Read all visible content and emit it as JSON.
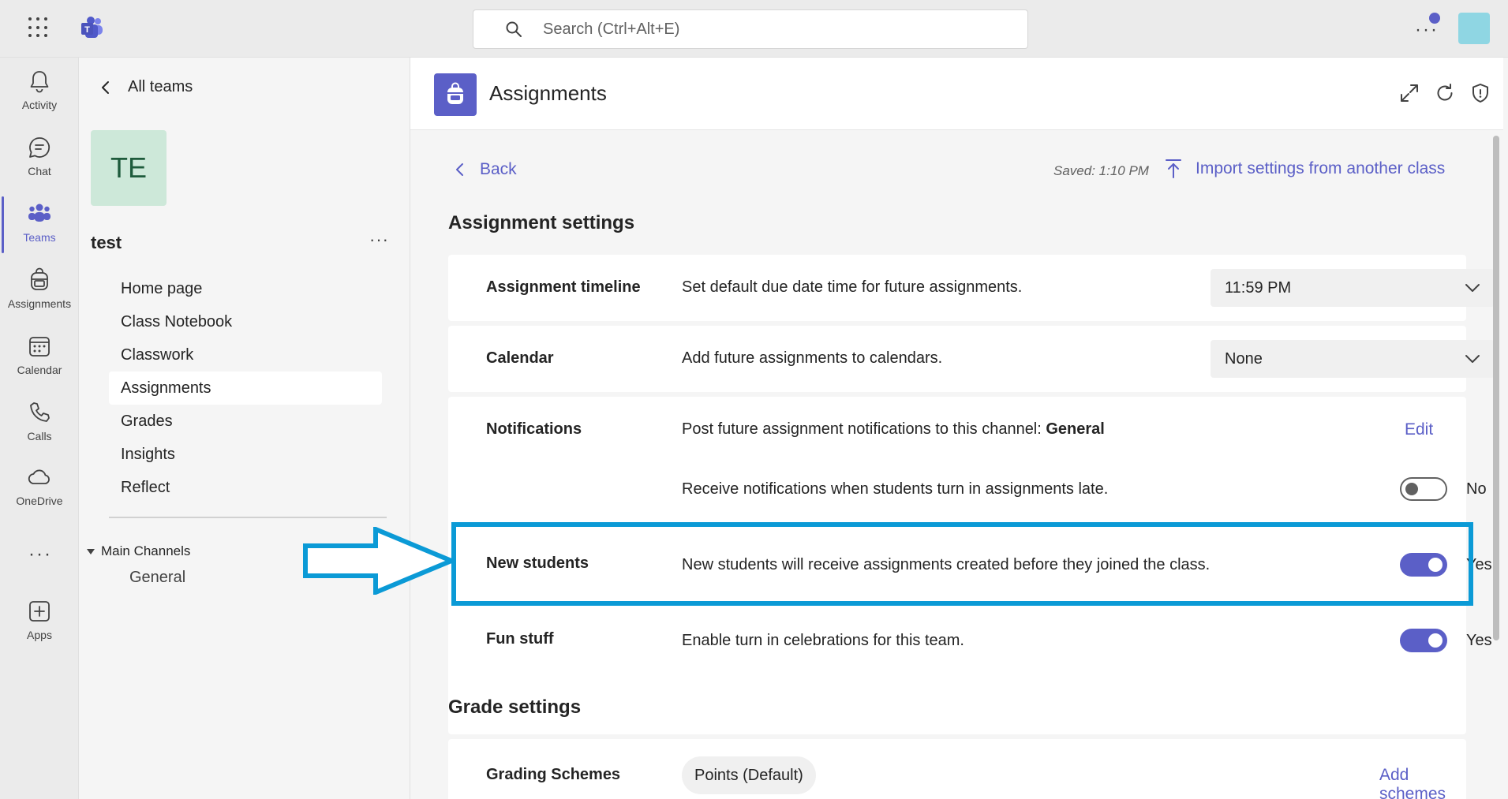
{
  "topbar": {
    "search_placeholder": "Search (Ctrl+Alt+E)"
  },
  "rail": {
    "items": [
      {
        "label": "Activity",
        "icon": "bell-icon"
      },
      {
        "label": "Chat",
        "icon": "chat-icon"
      },
      {
        "label": "Teams",
        "icon": "teams-icon"
      },
      {
        "label": "Assignments",
        "icon": "backpack-icon"
      },
      {
        "label": "Calendar",
        "icon": "calendar-icon"
      },
      {
        "label": "Calls",
        "icon": "phone-icon"
      },
      {
        "label": "OneDrive",
        "icon": "cloud-icon"
      },
      {
        "label": "Apps",
        "icon": "add-square-icon"
      }
    ],
    "more": "···"
  },
  "team_panel": {
    "back_label": "All teams",
    "avatar_initials": "TE",
    "team_name": "test",
    "more": "···",
    "nav": [
      "Home page",
      "Class Notebook",
      "Classwork",
      "Assignments",
      "Grades",
      "Insights",
      "Reflect"
    ],
    "channels_heading": "Main Channels",
    "channel": "General"
  },
  "app": {
    "title": "Assignments"
  },
  "settings": {
    "back_label": "Back",
    "saved": "Saved: 1:10 PM",
    "import_label": "Import settings from another class",
    "assignment_heading": "Assignment settings",
    "timeline": {
      "label": "Assignment timeline",
      "desc": "Set default due date time for future assignments.",
      "value": "11:59 PM"
    },
    "calendar": {
      "label": "Calendar",
      "desc": "Add future assignments to calendars.",
      "value": "None"
    },
    "notifications": {
      "label": "Notifications",
      "desc_prefix": "Post future assignment notifications to this channel: ",
      "desc_channel": "General",
      "edit_label": "Edit",
      "late_desc": "Receive notifications when students turn in assignments late.",
      "late_state": "No"
    },
    "new_students": {
      "label": "New students",
      "desc": "New students will receive assignments created before they joined the class.",
      "state": "Yes"
    },
    "fun_stuff": {
      "label": "Fun stuff",
      "desc": "Enable turn in celebrations for this team.",
      "state": "Yes"
    },
    "grade_heading": "Grade settings",
    "grading": {
      "label": "Grading Schemes",
      "pill": "Points (Default)",
      "add_label": "Add schemes"
    }
  },
  "colors": {
    "accent": "#5b5fc7",
    "highlight": "#0b9ad6"
  }
}
